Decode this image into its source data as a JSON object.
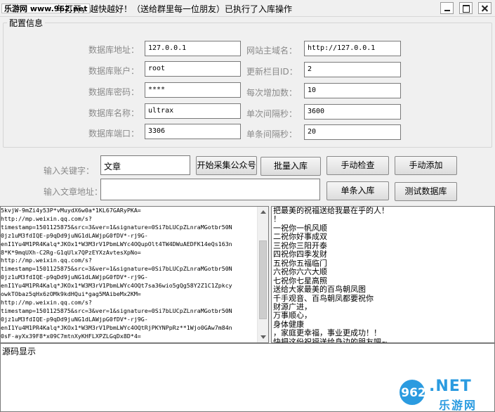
{
  "window": {
    "site_badge": "乐游网 www.962.net",
    "title": "年打开，越快越好！（送给群里每一位朋友）已执行了入库操作",
    "minimize_label": "",
    "maximize_label": "",
    "close_label": ""
  },
  "config": {
    "group_title": "配置信息",
    "db_host": {
      "label": "数据库地址：",
      "value": "127.0.0.1"
    },
    "db_user": {
      "label": "数据库账户：",
      "value": "root"
    },
    "db_password": {
      "label": "数据库密码：",
      "value": "****"
    },
    "db_name": {
      "label": "数据库名称：",
      "value": "ultrax"
    },
    "db_port": {
      "label": "数据库端口：",
      "value": "3306"
    },
    "site_domain": {
      "label": "网站主域名：",
      "value": "http://127.0.0.1"
    },
    "update_column_id": {
      "label": "更新栏目ID：",
      "value": "2"
    },
    "increment": {
      "label": "每次增加数：",
      "value": "10"
    },
    "interval_seconds": {
      "label": "单次间隔秒：",
      "value": "3600"
    },
    "item_interval_seconds": {
      "label": "单条间隔秒：",
      "value": "20"
    }
  },
  "actions": {
    "keyword_label": "输入关键字：",
    "keyword_value": "文章",
    "article_url_label": "输入文章地址：",
    "article_url_value": "",
    "collect_button": "开始采集公众号",
    "batch_import_button": "批量入库",
    "manual_check_button": "手动检查",
    "manual_add_button": "手动添加",
    "single_import_button": "单条入库",
    "test_db_button": "测试数据库"
  },
  "log_pane": {
    "lines": [
      "5kvjW-9mZi4y53P*vMuydX6w0a*1KL67GARyPKA=",
      "http://mp.weixin.qq.com/s?",
      "timestamp=1501125875&src=3&ver=1&signature=0Si7bLUCpZLnraMGotbr50N",
      "0jz1uM3fdIQE-p9qDd9juNG1dLAWjpG0fDV*-rj9G-",
      "enI1Yu4M1PR4Kalq*JKOx1*W3M3rV1PbmLWYc4OQupOlt4TW4DWuAEDFK14eQs163n",
      "8*K*9mqUXh-C2Rg-G1qUlx7QPzEYXzAvtesXpNo=",
      "http://mp.weixin.qq.com/s?",
      "timestamp=1501125875&src=3&ver=1&signature=0Si7bLUCpZLnraMGotbr50N",
      "0jz1uM3fdIQE-p9qDd9juNG1dLAWjpG0fDV*-rj9G-",
      "enI1Yu4M1PR4Kalq*JKOx1*W3M3rV1PbmLWYc4OQt7sa36wio5gQg58Y2Z1C1Zpkcy",
      "owkTObaz5qHx6zOMk9kdHQui*gag5MAibeMx2KM=",
      "http://mp.weixin.qq.com/s?",
      "timestamp=1501125875&src=3&ver=1&signature=0Si7bLUCpZLnraMGotbr50N",
      "0jz1uM3fdIQE-p9qDd9juNG1dLAWjpG0fDV*-rj9G-",
      "enI1Yu4M1PR4Kalq*JKOx1*W3M3rV1PbmLWYc4OQtRjPKYNPpRz**1Wjo0GAw7m84n",
      "0sF-ayXx39F8*x09C7mtnXyKHFLXPZLGqDx8D*4="
    ]
  },
  "message_pane": {
    "lines": [
      "把最美的祝福送给我最在乎的人！",
      "！",
      "一祝你一帆风顺",
      "二祝你好事成双",
      "三祝你三阳开泰",
      "四祝你四季发财",
      "五祝你五福临门",
      "六祝你六六大顺",
      "七祝你七星高照",
      "送给大家最美的百鸟朝凤图",
      "千手观音、百鸟朝凤都要祝你",
      "财源广进，",
      "万事顺心，",
      "身体健康",
      "，家庭更幸福，事业更成功！！",
      "快把这份祝福送给身边的朋友吧~"
    ]
  },
  "source_pane": {
    "label": "源码显示"
  },
  "watermark": {
    "circle_text": "962",
    "net_text": ".NET",
    "cn_text": "乐游网"
  }
}
